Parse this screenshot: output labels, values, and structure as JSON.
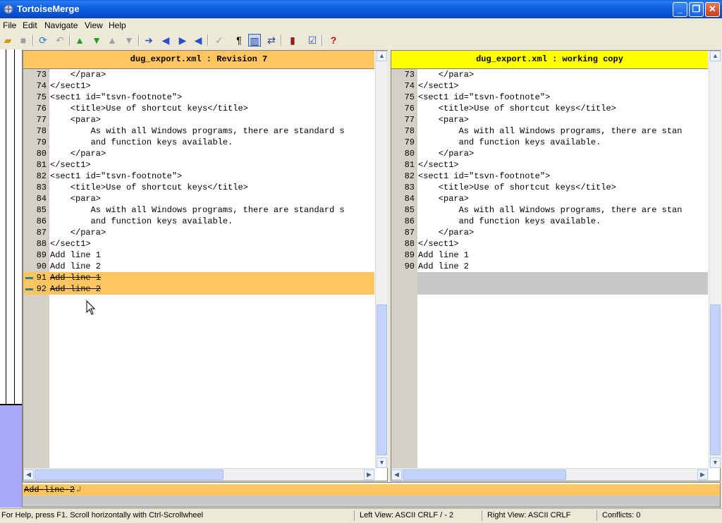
{
  "window": {
    "title": "TortoiseMerge",
    "minimize": "_",
    "maximize": "❐",
    "close": "✕"
  },
  "menu": [
    "File",
    "Edit",
    "Navigate",
    "View",
    "Help"
  ],
  "toolbar_icons": [
    "open-icon",
    "save-icon",
    "reload-icon",
    "undo-icon",
    "next-diff-icon",
    "prev-diff-icon",
    "next-conflict-icon",
    "prev-conflict-icon",
    "use-block-icon",
    "use-left-icon",
    "use-right-icon",
    "use-theirs-icon",
    "mark-resolved-icon",
    "whitespace-icon",
    "one-pane-icon",
    "two-pane-icon",
    "settings-icon",
    "patch-icon",
    "help-icon"
  ],
  "colors": {
    "left_header": "#ffc660",
    "right_header": "#ffff00",
    "removed": "#ffc660",
    "empty": "#c8c8c8"
  },
  "left": {
    "header": "dug_export.xml : Revision 7",
    "lines": [
      {
        "n": "73",
        "t": "    </para>",
        "s": ""
      },
      {
        "n": "74",
        "t": "</sect1>",
        "s": ""
      },
      {
        "n": "75",
        "t": "<sect1 id=\"tsvn-footnote\">",
        "s": ""
      },
      {
        "n": "76",
        "t": "    <title>Use of shortcut keys</title>",
        "s": ""
      },
      {
        "n": "77",
        "t": "    <para>",
        "s": ""
      },
      {
        "n": "78",
        "t": "        As with all Windows programs, there are standard s",
        "s": ""
      },
      {
        "n": "79",
        "t": "        and function keys available.",
        "s": ""
      },
      {
        "n": "80",
        "t": "    </para>",
        "s": ""
      },
      {
        "n": "81",
        "t": "</sect1>",
        "s": ""
      },
      {
        "n": "82",
        "t": "<sect1 id=\"tsvn-footnote\">",
        "s": ""
      },
      {
        "n": "83",
        "t": "    <title>Use of shortcut keys</title>",
        "s": ""
      },
      {
        "n": "84",
        "t": "    <para>",
        "s": ""
      },
      {
        "n": "85",
        "t": "        As with all Windows programs, there are standard s",
        "s": ""
      },
      {
        "n": "86",
        "t": "        and function keys available.",
        "s": ""
      },
      {
        "n": "87",
        "t": "    </para>",
        "s": ""
      },
      {
        "n": "88",
        "t": "</sect1>",
        "s": ""
      },
      {
        "n": "89",
        "t": "Add line 1",
        "s": ""
      },
      {
        "n": "90",
        "t": "Add line 2",
        "s": ""
      },
      {
        "n": "91",
        "t": "Add line 1",
        "s": "removed"
      },
      {
        "n": "92",
        "t": "Add line 2",
        "s": "removed"
      }
    ]
  },
  "right": {
    "header": "dug_export.xml : working copy",
    "lines": [
      {
        "n": "73",
        "t": "    </para>",
        "s": ""
      },
      {
        "n": "74",
        "t": "</sect1>",
        "s": ""
      },
      {
        "n": "75",
        "t": "<sect1 id=\"tsvn-footnote\">",
        "s": ""
      },
      {
        "n": "76",
        "t": "    <title>Use of shortcut keys</title>",
        "s": ""
      },
      {
        "n": "77",
        "t": "    <para>",
        "s": ""
      },
      {
        "n": "78",
        "t": "        As with all Windows programs, there are stan",
        "s": ""
      },
      {
        "n": "79",
        "t": "        and function keys available.",
        "s": ""
      },
      {
        "n": "80",
        "t": "    </para>",
        "s": ""
      },
      {
        "n": "81",
        "t": "</sect1>",
        "s": ""
      },
      {
        "n": "82",
        "t": "<sect1 id=\"tsvn-footnote\">",
        "s": ""
      },
      {
        "n": "83",
        "t": "    <title>Use of shortcut keys</title>",
        "s": ""
      },
      {
        "n": "84",
        "t": "    <para>",
        "s": ""
      },
      {
        "n": "85",
        "t": "        As with all Windows programs, there are stan",
        "s": ""
      },
      {
        "n": "86",
        "t": "        and function keys available.",
        "s": ""
      },
      {
        "n": "87",
        "t": "    </para>",
        "s": ""
      },
      {
        "n": "88",
        "t": "</sect1>",
        "s": ""
      },
      {
        "n": "89",
        "t": "Add line 1",
        "s": ""
      },
      {
        "n": "90",
        "t": "Add line 2",
        "s": ""
      },
      {
        "n": "",
        "t": "",
        "s": "empty"
      },
      {
        "n": "",
        "t": "",
        "s": "empty"
      }
    ]
  },
  "bottom": {
    "line": "Add·line·2"
  },
  "status": {
    "help": "For Help, press F1. Scroll horizontally with Ctrl-Scrollwheel",
    "left_view": "Left View: ASCII CRLF  / - 2",
    "right_view": "Right View: ASCII CRLF",
    "conflicts": "Conflicts: 0"
  }
}
